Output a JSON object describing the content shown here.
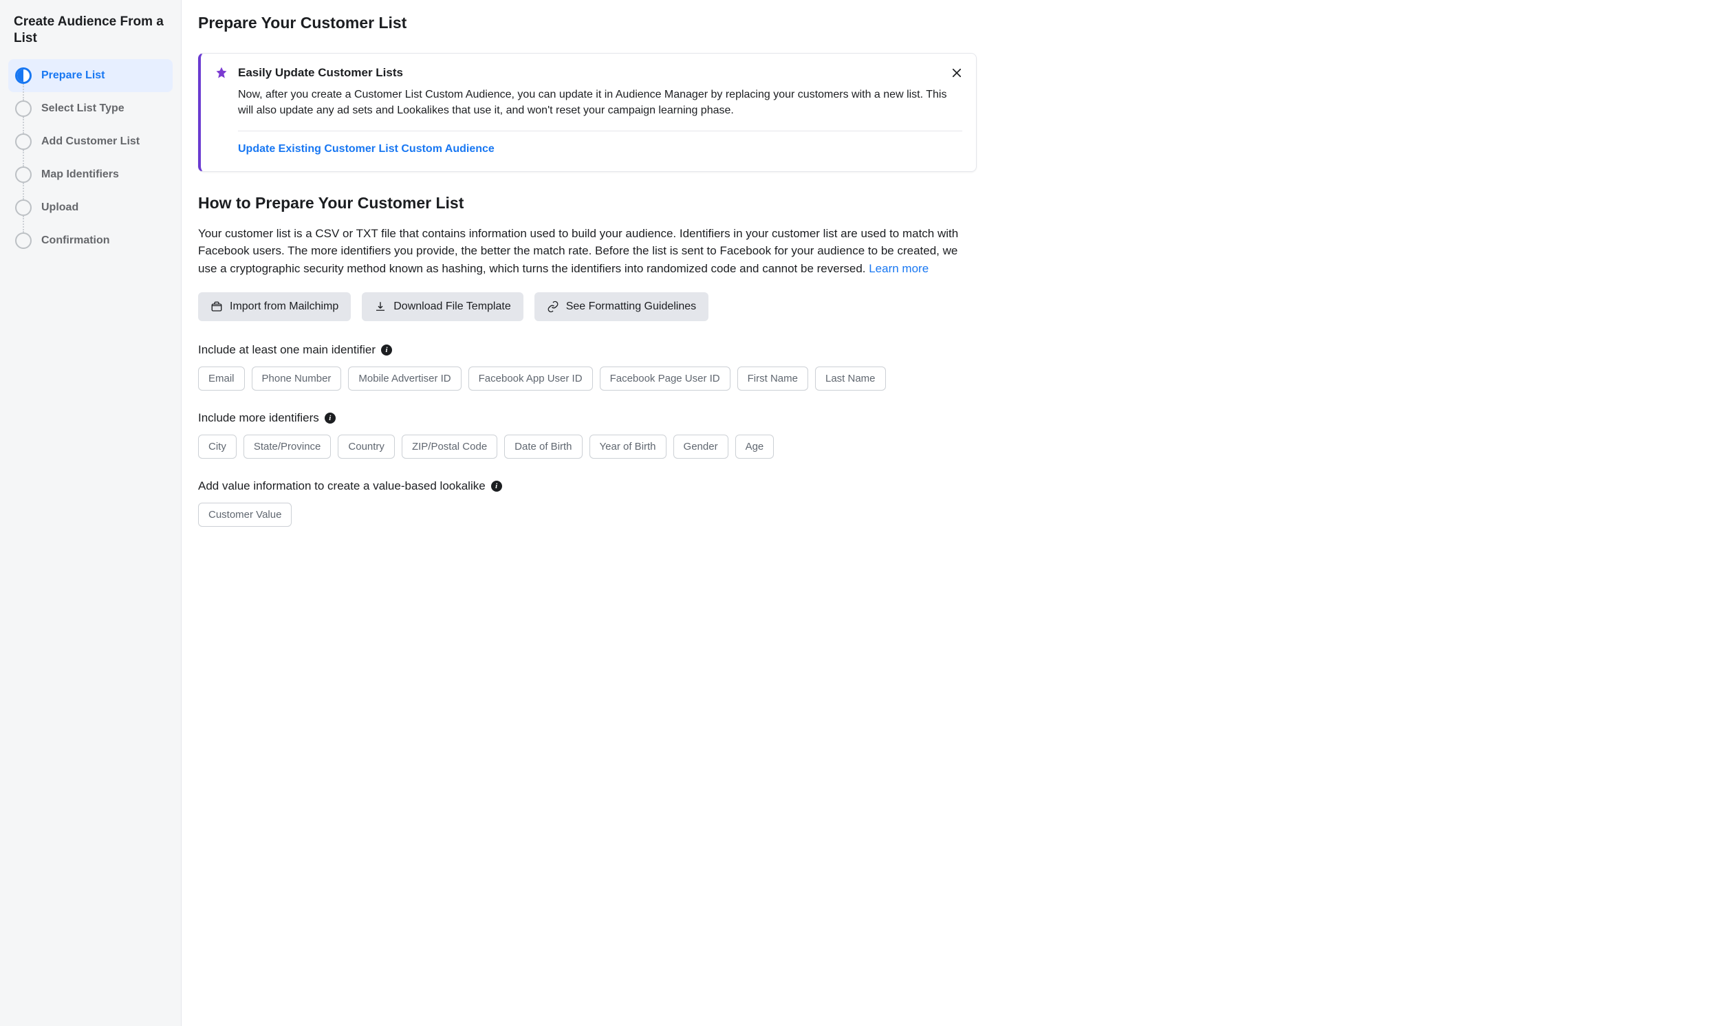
{
  "sidebar": {
    "title": "Create Audience From a List",
    "steps": [
      {
        "label": "Prepare List",
        "active": true
      },
      {
        "label": "Select List Type",
        "active": false
      },
      {
        "label": "Add Customer List",
        "active": false
      },
      {
        "label": "Map Identifiers",
        "active": false
      },
      {
        "label": "Upload",
        "active": false
      },
      {
        "label": "Confirmation",
        "active": false
      }
    ]
  },
  "main": {
    "page_title": "Prepare Your Customer List",
    "notice": {
      "title": "Easily Update Customer Lists",
      "body": "Now, after you create a Customer List Custom Audience, you can update it in Audience Manager by replacing your customers with a new list. This will also update any ad sets and Lookalikes that use it, and won't reset your campaign learning phase.",
      "link": "Update Existing Customer List Custom Audience"
    },
    "howto": {
      "title": "How to Prepare Your Customer List",
      "body": "Your customer list is a CSV or TXT file that contains information used to build your audience. Identifiers in your customer list are used to match with Facebook users. The more identifiers you provide, the better the match rate. Before the list is sent to Facebook for your audience to be created, we use a cryptographic security method known as hashing, which turns the identifiers into randomized code and cannot be reversed. ",
      "learn_more": "Learn more"
    },
    "actions": {
      "import_mailchimp": "Import from Mailchimp",
      "download_template": "Download File Template",
      "formatting_guidelines": "See Formatting Guidelines"
    },
    "identifiers": {
      "main_label": "Include at least one main identifier",
      "main_chips": [
        "Email",
        "Phone Number",
        "Mobile Advertiser ID",
        "Facebook App User ID",
        "Facebook Page User ID",
        "First Name",
        "Last Name"
      ],
      "more_label": "Include more identifiers",
      "more_chips": [
        "City",
        "State/Province",
        "Country",
        "ZIP/Postal Code",
        "Date of Birth",
        "Year of Birth",
        "Gender",
        "Age"
      ],
      "value_label": "Add value information to create a value-based lookalike",
      "value_chips": [
        "Customer Value"
      ]
    }
  }
}
